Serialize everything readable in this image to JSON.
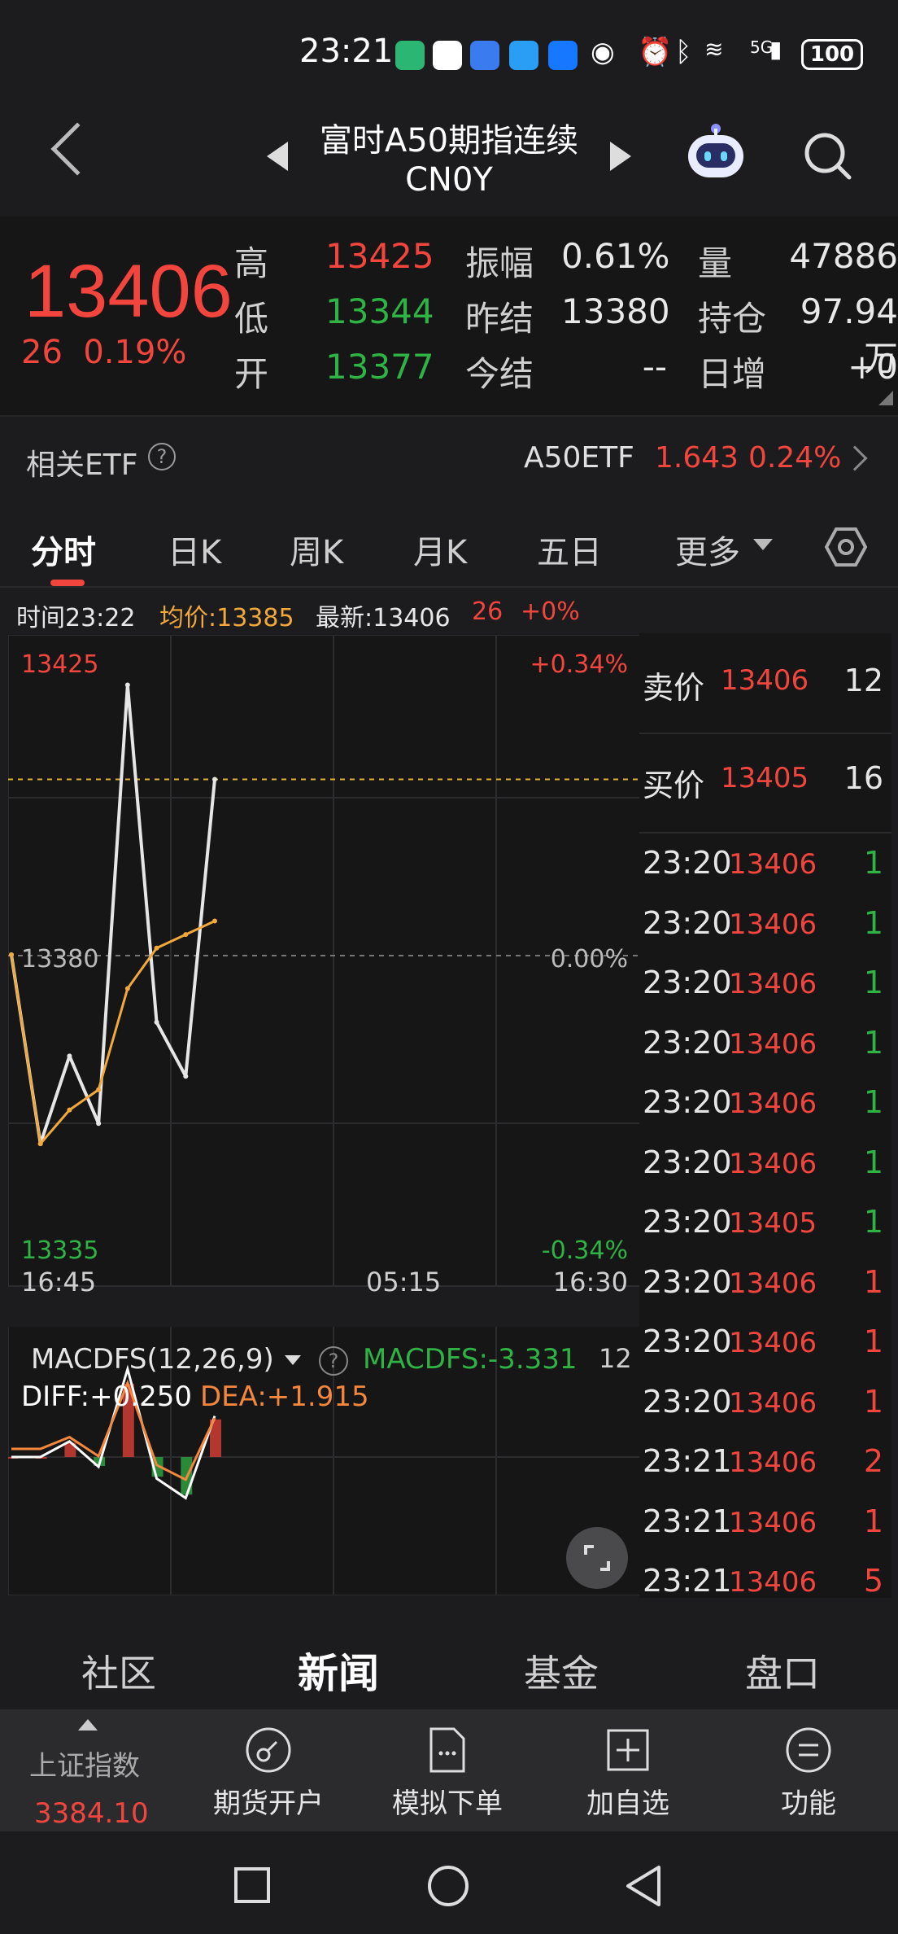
{
  "status_bar": {
    "time": "23:21",
    "battery": "100",
    "network": "5G"
  },
  "header": {
    "title": "富时A50期指连续",
    "subtitle": "CN0Y"
  },
  "quote": {
    "price": "13406",
    "change": "26",
    "change_pct": "0.19%",
    "high_label": "高",
    "high": "13425",
    "low_label": "低",
    "low": "13344",
    "open_label": "开",
    "open": "13377",
    "amp_label": "振幅",
    "amp": "0.61%",
    "prev_settle_label": "昨结",
    "prev_settle": "13380",
    "settle_label": "今结",
    "settle": "--",
    "vol_label": "量",
    "vol": "47886",
    "oi_label": "持仓",
    "oi": "97.94万",
    "daily_inc_label": "日增",
    "daily_inc": "+0"
  },
  "related_etf": {
    "label": "相关ETF",
    "name": "A50ETF",
    "price": "1.643",
    "pct": "0.24%"
  },
  "tabs": {
    "t1": "分时",
    "t2": "日K",
    "t3": "周K",
    "t4": "月K",
    "t5": "五日",
    "t6": "更多"
  },
  "info_line": {
    "time": "时间23:22",
    "avg": "均价:13385",
    "latest": "最新:13406",
    "chg": "26",
    "pct": "+0%"
  },
  "chart_data": {
    "type": "line",
    "series": [
      {
        "name": "price",
        "x": [
          "16:45",
          "18:00",
          "19:30",
          "21:00",
          "22:10",
          "22:30",
          "23:00",
          "23:22"
        ],
        "values": [
          13380,
          13352,
          13365,
          13355,
          13420,
          13370,
          13362,
          13406
        ]
      },
      {
        "name": "avg",
        "x": [
          "16:45",
          "18:00",
          "19:30",
          "21:00",
          "22:10",
          "22:30",
          "23:00",
          "23:22"
        ],
        "values": [
          13380,
          13352,
          13357,
          13360,
          13375,
          13381,
          13383,
          13385
        ]
      }
    ],
    "ylim": [
      13335,
      13425
    ],
    "y_labels": {
      "top": "13425",
      "mid": "13380",
      "bottom": "13335"
    },
    "pct_labels": {
      "top": "+0.34%",
      "mid": "0.00%",
      "bottom": "-0.34%"
    },
    "x_ticks": [
      "16:45",
      "05:15",
      "16:30"
    ]
  },
  "macd": {
    "name": "MACDFS(12,26,9)",
    "value": "MACDFS:-3.331",
    "num": "12",
    "diff": "DIFF:+0.250",
    "dea": "DEA:+1.915"
  },
  "orderbook": {
    "ask_label": "卖价",
    "ask_price": "13406",
    "ask_qty": "12",
    "bid_label": "买价",
    "bid_price": "13405",
    "bid_qty": "16",
    "trades": [
      {
        "time": "23:20",
        "price": "13406",
        "vol": "1",
        "color": "#2fb344"
      },
      {
        "time": "23:20",
        "price": "13406",
        "vol": "1",
        "color": "#2fb344"
      },
      {
        "time": "23:20",
        "price": "13406",
        "vol": "1",
        "color": "#2fb344"
      },
      {
        "time": "23:20",
        "price": "13406",
        "vol": "1",
        "color": "#2fb344"
      },
      {
        "time": "23:20",
        "price": "13406",
        "vol": "1",
        "color": "#2fb344"
      },
      {
        "time": "23:20",
        "price": "13406",
        "vol": "1",
        "color": "#2fb344"
      },
      {
        "time": "23:20",
        "price": "13405",
        "vol": "1",
        "color": "#2fb344"
      },
      {
        "time": "23:20",
        "price": "13406",
        "vol": "1",
        "color": "#f2453d"
      },
      {
        "time": "23:20",
        "price": "13406",
        "vol": "1",
        "color": "#f2453d"
      },
      {
        "time": "23:20",
        "price": "13406",
        "vol": "1",
        "color": "#f2453d"
      },
      {
        "time": "23:21",
        "price": "13406",
        "vol": "2",
        "color": "#f2453d"
      },
      {
        "time": "23:21",
        "price": "13406",
        "vol": "1",
        "color": "#f2453d"
      },
      {
        "time": "23:21",
        "price": "13406",
        "vol": "5",
        "color": "#f2453d"
      }
    ]
  },
  "sub_tabs": {
    "s1": "社区",
    "s2": "新闻",
    "s3": "基金",
    "s4": "盘口"
  },
  "bottom_bar": {
    "index_name": "上证指数",
    "index_value": "3384.10",
    "b1": "期货开户",
    "b2": "模拟下单",
    "b3": "加自选",
    "b4": "功能"
  },
  "colors": {
    "up": "#f2453d",
    "down": "#2fb344",
    "avg": "#f2a93b",
    "bg": "#1c1c1e"
  }
}
